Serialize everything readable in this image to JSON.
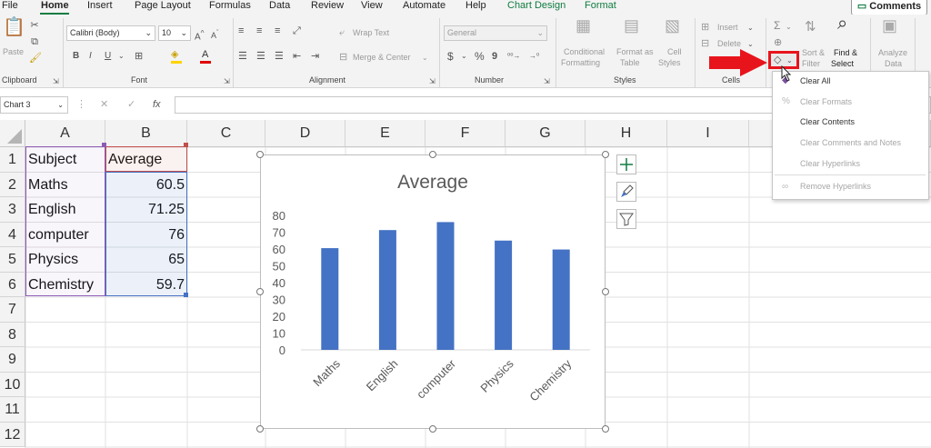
{
  "tabs": [
    {
      "label": "File"
    },
    {
      "label": "Home"
    },
    {
      "label": "Insert"
    },
    {
      "label": "Page Layout"
    },
    {
      "label": "Formulas"
    },
    {
      "label": "Data"
    },
    {
      "label": "Review"
    },
    {
      "label": "View"
    },
    {
      "label": "Automate"
    },
    {
      "label": "Help"
    },
    {
      "label": "Chart Design"
    },
    {
      "label": "Format"
    }
  ],
  "comments_label": "Comments",
  "ribbon": {
    "clipboard": {
      "label": "Clipboard",
      "paste": "Paste"
    },
    "font": {
      "label": "Font",
      "name": "Calibri (Body)",
      "size": "10"
    },
    "alignment": {
      "label": "Alignment",
      "wrap_text": "Wrap Text",
      "merge_center": "Merge & Center"
    },
    "number": {
      "label": "Number",
      "format": "General"
    },
    "styles": {
      "label": "Styles",
      "conditional_1": "Conditional",
      "conditional_2": "Formatting",
      "format_table_1": "Format as",
      "format_table_2": "Table",
      "cell_styles_1": "Cell",
      "cell_styles_2": "Styles"
    },
    "cells": {
      "label": "Cells",
      "insert": "Insert",
      "delete": "Delete"
    },
    "editing": {
      "sort_1": "Sort &",
      "sort_2": "Filter",
      "find_1": "Find &",
      "find_2": "Select"
    },
    "analysis": {
      "analyze_1": "Analyze",
      "analyze_2": "Data"
    }
  },
  "namebox": "Chart 3",
  "fx": "fx",
  "columns": [
    "A",
    "B",
    "C",
    "D",
    "E",
    "F",
    "G",
    "H",
    "I"
  ],
  "rows": [
    "1",
    "2",
    "3",
    "4",
    "5",
    "6",
    "7",
    "8",
    "9",
    "10",
    "11",
    "12"
  ],
  "table": {
    "headers": [
      "Subject",
      "Average"
    ],
    "rows": [
      [
        "Maths",
        "60.5"
      ],
      [
        "English",
        "71.25"
      ],
      [
        "computer",
        "76"
      ],
      [
        "Physics",
        "65"
      ],
      [
        "Chemistry",
        "59.7"
      ]
    ]
  },
  "chart_data": {
    "type": "bar",
    "title": "Average",
    "categories": [
      "Maths",
      "English",
      "computer",
      "Physics",
      "Chemistry"
    ],
    "values": [
      60.5,
      71.25,
      76,
      65,
      59.7
    ],
    "ylim": [
      0,
      80
    ],
    "yticks": [
      "0",
      "10",
      "20",
      "30",
      "40",
      "50",
      "60",
      "70",
      "80"
    ],
    "color": "#4472c4",
    "legend": "none",
    "grid": false
  },
  "clear_menu": {
    "items": [
      {
        "label": "Clear All",
        "enabled": true
      },
      {
        "label": "Clear Formats",
        "enabled": false
      },
      {
        "label": "Clear Contents",
        "enabled": true
      },
      {
        "label": "Clear Comments and Notes",
        "enabled": false
      },
      {
        "label": "Clear Hyperlinks",
        "enabled": false
      },
      {
        "label": "Remove Hyperlinks",
        "enabled": false
      }
    ]
  },
  "colors": {
    "accent": "#107c41",
    "arrow": "#e8141c",
    "highlight_border": "#e8141c",
    "series": "#4472c4"
  }
}
